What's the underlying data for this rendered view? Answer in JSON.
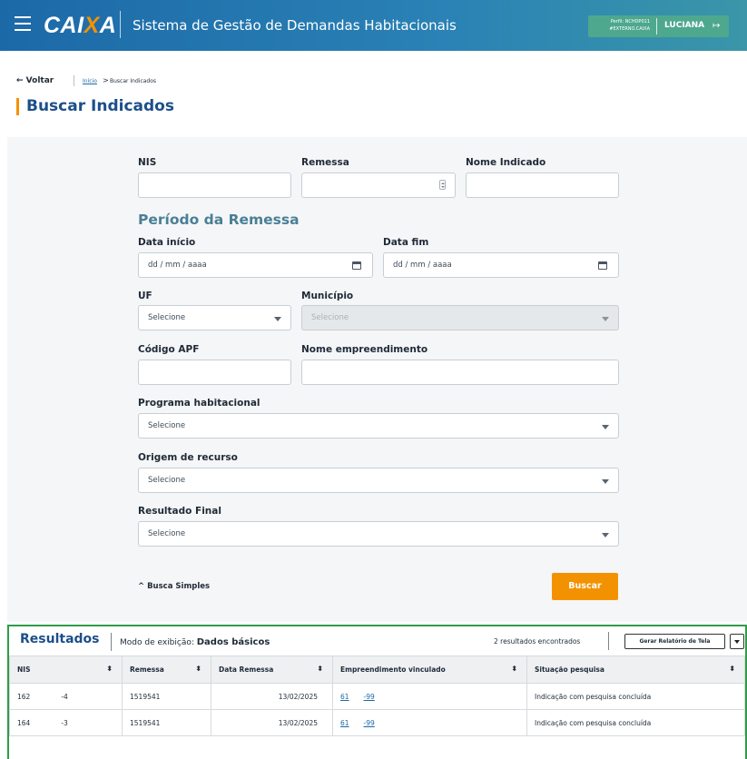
{
  "header": {
    "logo_main": "CAI",
    "logo_x": "X",
    "logo_end": "A",
    "app_title": "Sistema de Gestão de Demandas Habitacionais",
    "profile_line1": "Perfil: NCHDP011",
    "profile_line2": "#EXTERNO.CAIXA",
    "user_name": "LUCIANA"
  },
  "breadcrumb": {
    "back": "← Voltar",
    "home": "Início",
    "arrow": ">",
    "current": "Buscar Indicados"
  },
  "page_title": "Buscar Indicados",
  "form": {
    "nis_label": "NIS",
    "remessa_label": "Remessa",
    "nome_indicado_label": "Nome Indicado",
    "periodo_title": "Período da Remessa",
    "data_inicio_label": "Data início",
    "data_inicio_placeholder": "dd / mm / aaaa",
    "data_fim_label": "Data fim",
    "data_fim_placeholder": "dd / mm / aaaa",
    "uf_label": "UF",
    "uf_value": "Selecione",
    "municipio_label": "Município",
    "municipio_value": "Selecione",
    "codigo_apf_label": "Código APF",
    "nome_empreendimento_label": "Nome empreendimento",
    "programa_label": "Programa habitacional",
    "programa_value": "Selecione",
    "origem_label": "Origem de recurso",
    "origem_value": "Selecione",
    "resultado_label": "Resultado Final",
    "resultado_value": "Selecione",
    "busca_simples": "^ Busca Simples",
    "buscar_button": "Buscar"
  },
  "results": {
    "title": "Resultados",
    "mode_label": "Modo de exibição: ",
    "mode_value": "Dados básicos",
    "found": "2 resultados encontrados",
    "report_button": "Gerar Relatório de Tela",
    "columns": [
      "NIS",
      "Remessa",
      "Data Remessa",
      "Empreendimento vinculado",
      "Situação pesquisa"
    ],
    "sort_glyph": "⬍",
    "rows": [
      {
        "nis_a": "162",
        "nis_b": "-4",
        "remessa": "1519541",
        "data": "13/02/2025",
        "emp_a": "61",
        "emp_b": "-99",
        "situacao": "Indicação com pesquisa concluída"
      },
      {
        "nis_a": "164",
        "nis_b": "-3",
        "remessa": "1519541",
        "data": "13/02/2025",
        "emp_a": "61",
        "emp_b": "-99",
        "situacao": "Indicação com pesquisa concluída"
      }
    ]
  },
  "colors": {
    "accent_orange": "#f39200",
    "brand_blue": "#1c69a8",
    "results_border": "#2f9c4a",
    "section_title": "#4a7f96"
  },
  "icons": [
    "menu-icon",
    "logout-icon",
    "calendar-icon",
    "caret-down-icon",
    "spinner-icon",
    "sort-icon",
    "chevron-up-icon"
  ]
}
